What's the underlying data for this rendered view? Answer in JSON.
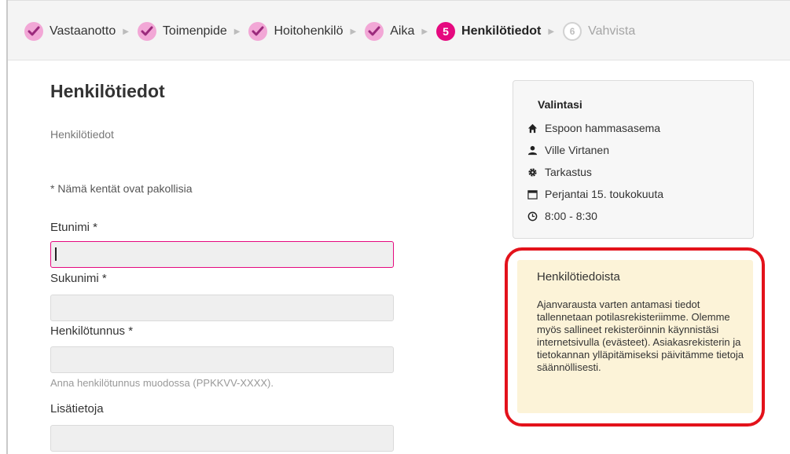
{
  "steps": [
    {
      "label": "Vastaanotto",
      "state": "done"
    },
    {
      "label": "Toimenpide",
      "state": "done"
    },
    {
      "label": "Hoitohenkilö",
      "state": "done"
    },
    {
      "label": "Aika",
      "state": "done"
    },
    {
      "label": "Henkilötiedot",
      "state": "current",
      "number": "5"
    },
    {
      "label": "Vahvista",
      "state": "pending",
      "number": "6"
    }
  ],
  "page": {
    "title": "Henkilötiedot",
    "subtitle": "Henkilötiedot",
    "required_note": "* Nämä kentät ovat pakollisia"
  },
  "form": {
    "first_name": {
      "label": "Etunimi *",
      "value": ""
    },
    "last_name": {
      "label": "Sukunimi *",
      "value": ""
    },
    "ssn": {
      "label": "Henkilötunnus *",
      "value": "",
      "hint": "Anna henkilötunnus muodossa (PPKKVV-XXXX)."
    },
    "extra": {
      "label": "Lisätietoja",
      "value": ""
    }
  },
  "selection": {
    "title": "Valintasi",
    "clinic": "Espoon hammasasema",
    "person": "Ville Virtanen",
    "procedure": "Tarkastus",
    "date": "Perjantai 15. toukokuuta",
    "time": "8:00 - 8:30"
  },
  "info": {
    "title": "Henkilötiedoista",
    "text": "Ajanvarausta varten antamasi tiedot tallennetaan potilasrekisteriimme. Olemme myös sallineet rekisteröinnin käynnistäsi internetsivulla (evästeet). Asiakasrekisterin ja tietokannan ylläpitämiseksi päivitämme tietoja säännöllisesti."
  },
  "colors": {
    "accent": "#e5097f",
    "done_badge": "#f2a7d6",
    "info_bg": "#fcf3d8",
    "highlight": "#e3121b"
  }
}
